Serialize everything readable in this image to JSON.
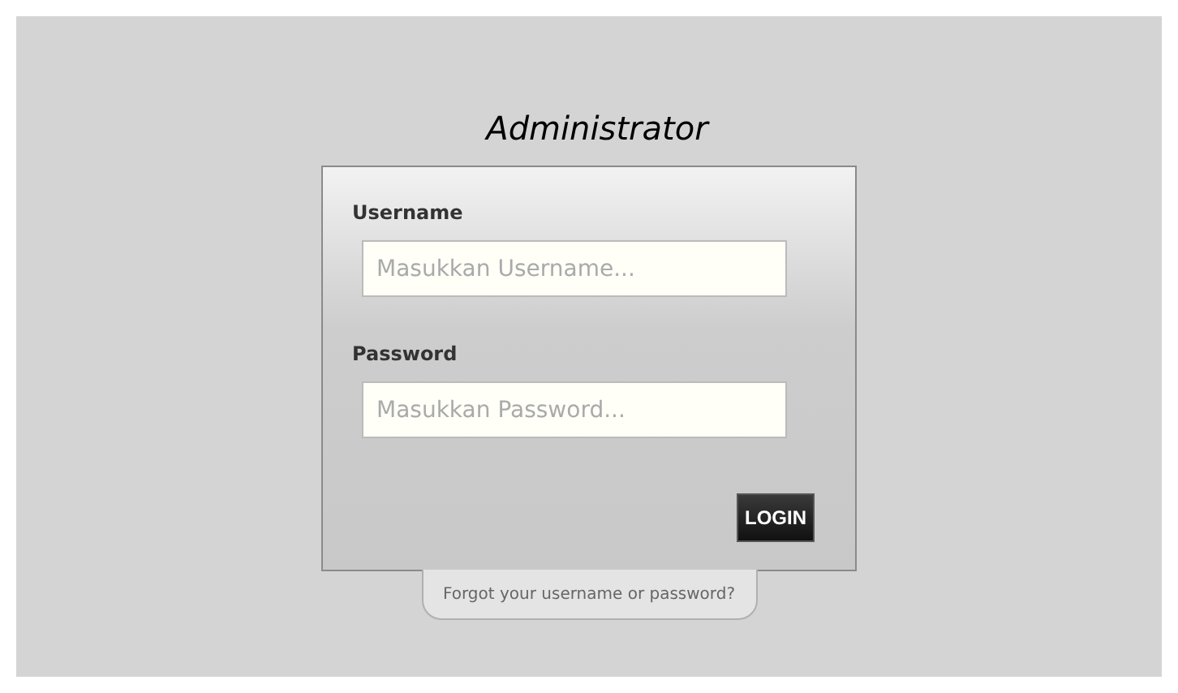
{
  "title": "Administrator",
  "fields": [
    {
      "label": "Username",
      "placeholder": "Masukkan Username..."
    },
    {
      "label": "Password",
      "placeholder": "Masukkan Password..."
    }
  ],
  "login_button": "LOGIN",
  "forgot_link": "Forgot your username or password?"
}
